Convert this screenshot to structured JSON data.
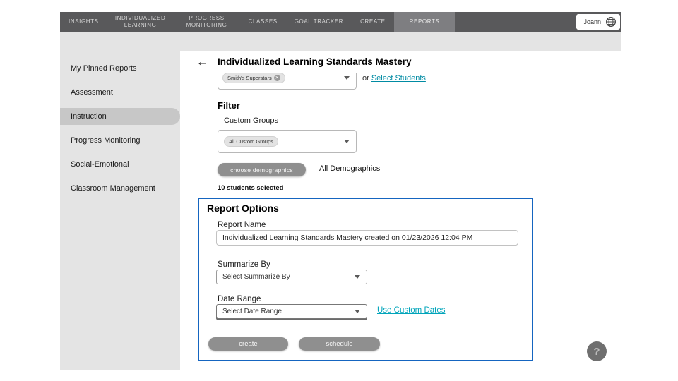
{
  "nav": {
    "items": [
      {
        "label": "INSIGHTS",
        "active": false
      },
      {
        "label": "INDIVIDUALIZED LEARNING",
        "active": false
      },
      {
        "label": "PROGRESS MONITORING",
        "active": false
      },
      {
        "label": "CLASSES",
        "active": false
      },
      {
        "label": "GOAL TRACKER",
        "active": false
      },
      {
        "label": "CREATE",
        "active": false
      },
      {
        "label": "REPORTS",
        "active": true
      }
    ],
    "user": {
      "name": "Joann"
    }
  },
  "sidebar": {
    "items": [
      {
        "label": "My Pinned Reports",
        "active": false
      },
      {
        "label": "Assessment",
        "active": false
      },
      {
        "label": "Instruction",
        "active": true
      },
      {
        "label": "Progress Monitoring",
        "active": false
      },
      {
        "label": "Social-Emotional",
        "active": false
      },
      {
        "label": "Classroom Management",
        "active": false
      }
    ]
  },
  "header": {
    "title": "Individualized Learning Standards Mastery"
  },
  "content": {
    "class_select": {
      "chip": "Smith's Superstars",
      "or_label": "or",
      "link": "Select Students"
    },
    "filter": {
      "heading": "Filter",
      "custom_groups_label": "Custom Groups",
      "custom_groups_value": "All Custom Groups",
      "choose_demographics_button": "choose demographics",
      "demographics_value": "All Demographics",
      "students_selected": "10 students selected"
    },
    "report_options": {
      "heading": "Report Options",
      "report_name_label": "Report Name",
      "report_name_value": "Individualized Learning Standards Mastery created on 01/23/2026 12:04 PM",
      "summarize_by_label": "Summarize By",
      "summarize_by_value": "Select Summarize By",
      "date_range_label": "Date Range",
      "date_range_value": "Select Date Range",
      "custom_dates_link": "Use Custom Dates",
      "create_button": "create",
      "schedule_button": "schedule"
    }
  },
  "icons": {
    "back": "←",
    "help": "?",
    "chip_remove": "✕"
  },
  "colors": {
    "accent_blue": "#1565c0",
    "link_teal": "#00a4ba",
    "nav_bg": "#59595b",
    "nav_active_bg": "#7e7e81",
    "sidebar_bg": "#e4e4e4",
    "sidebar_active_bg": "#c7c7c7",
    "button_gray": "#8f8f8f"
  }
}
